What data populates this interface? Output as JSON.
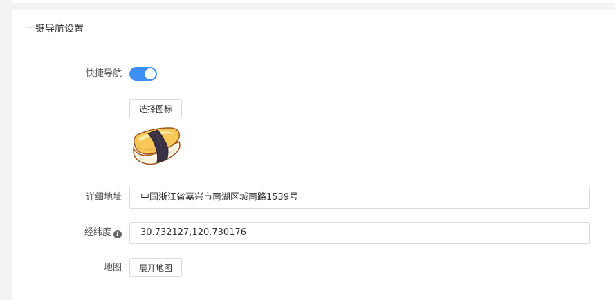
{
  "panel": {
    "title": "一键导航设置"
  },
  "form": {
    "quick_nav": {
      "label": "快捷导航",
      "enabled": true
    },
    "icon": {
      "button_label": "选择图标",
      "preview_icon": "sushi-icon"
    },
    "address": {
      "label": "详细地址",
      "value": "中国浙江省嘉兴市南湖区城南路1539号"
    },
    "coordinates": {
      "label": "经纬度",
      "info_icon": "info-icon",
      "value": "30.732127,120.730176"
    },
    "map": {
      "label": "地图",
      "button_label": "展开地图"
    }
  },
  "colors": {
    "accent": "#3d8ff5",
    "page_background": "#f3f3f3",
    "panel_background": "#ffffff"
  }
}
